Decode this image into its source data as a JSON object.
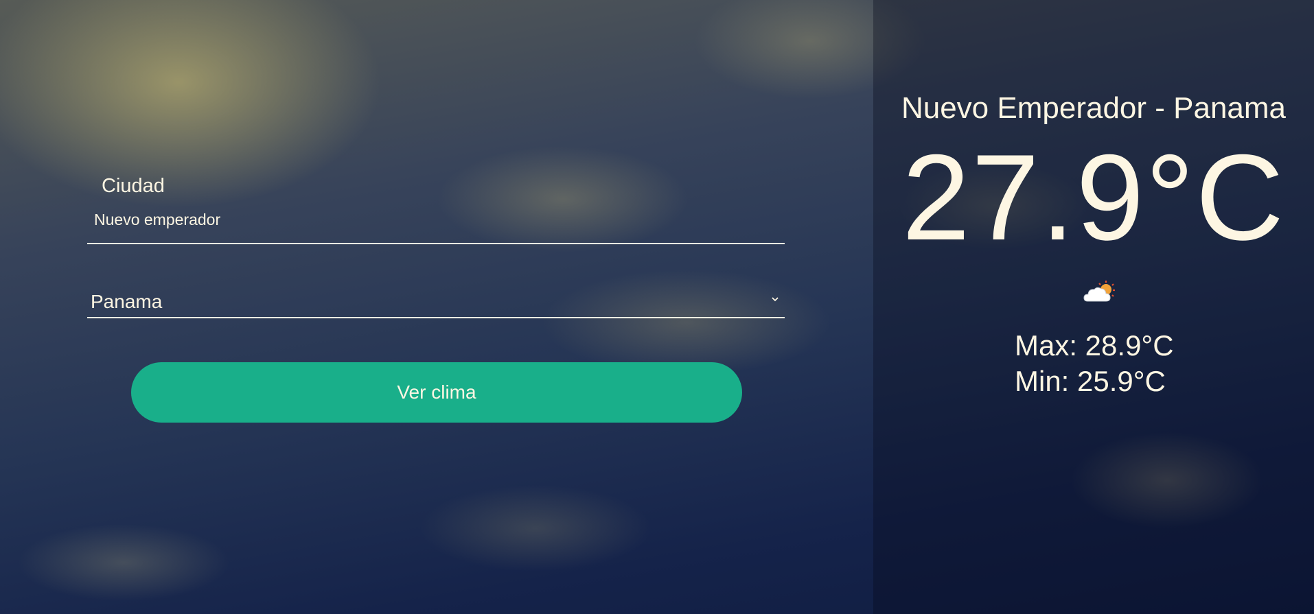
{
  "form": {
    "city_label": "Ciudad",
    "city_value": "Nuevo emperador",
    "country_value": "Panama",
    "submit_label": "Ver clima"
  },
  "weather": {
    "location": "Nuevo Emperador - Panama",
    "temperature": "27.9°C",
    "icon": "partly-cloudy-sun-icon",
    "max": "Max: 28.9°C",
    "min": "Min: 25.9°C"
  },
  "colors": {
    "accent": "#19af8a",
    "text": "#fdf6e3"
  }
}
